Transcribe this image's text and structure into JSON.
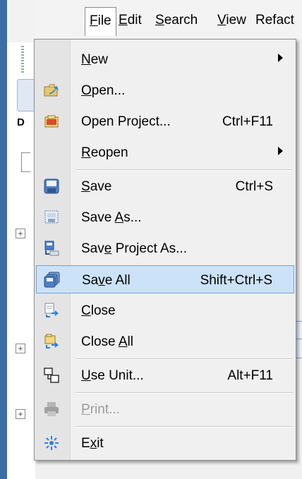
{
  "menubar": {
    "items": [
      {
        "text": "File",
        "mnemonic": "F"
      },
      {
        "text": "Edit",
        "mnemonic": "E"
      },
      {
        "text": "Search",
        "mnemonic": "S"
      },
      {
        "text": "View",
        "mnemonic": "V"
      },
      {
        "text": "Refact",
        "mnemonic": ""
      }
    ]
  },
  "file_menu": {
    "items": [
      {
        "label": "New",
        "mnemonic_index": 0,
        "shortcut": "",
        "submenu": true,
        "icon": "none"
      },
      {
        "label": "Open...",
        "mnemonic_index": 0,
        "shortcut": "",
        "icon": "open-folder-icon"
      },
      {
        "label": "Open Project...",
        "mnemonic_index": -1,
        "shortcut": "Ctrl+F11",
        "icon": "open-project-icon"
      },
      {
        "label": "Reopen",
        "mnemonic_index": 0,
        "shortcut": "",
        "submenu": true,
        "icon": "none"
      },
      {
        "label": "Save",
        "mnemonic_index": 0,
        "shortcut": "Ctrl+S",
        "icon": "save-icon"
      },
      {
        "label": "Save As...",
        "mnemonic_index": 5,
        "shortcut": "",
        "icon": "save-as-icon"
      },
      {
        "label": "Save Project As...",
        "mnemonic_index": 3,
        "shortcut": "",
        "icon": "save-project-icon"
      },
      {
        "label": "Save All",
        "mnemonic_index": 2,
        "shortcut": "Shift+Ctrl+S",
        "icon": "save-all-icon",
        "selected": true
      },
      {
        "label": "Close",
        "mnemonic_index": 0,
        "shortcut": "",
        "icon": "close-file-icon"
      },
      {
        "label": "Close All",
        "mnemonic_index": 6,
        "shortcut": "",
        "icon": "close-all-icon"
      },
      {
        "label": "Use Unit...",
        "mnemonic_index": 0,
        "shortcut": "Alt+F11",
        "icon": "use-unit-icon"
      },
      {
        "label": "Print...",
        "mnemonic_index": 0,
        "shortcut": "",
        "icon": "print-icon",
        "disabled": true
      },
      {
        "label": "Exit",
        "mnemonic_index": 1,
        "shortcut": "",
        "icon": "exit-icon"
      }
    ]
  },
  "colors": {
    "selection_bg": "#cce2f8",
    "selection_border": "#6fa3d8",
    "menu_bg": "#f0f0f0",
    "gutter_bg": "#e4e4e4",
    "disabled_text": "#9b9b9b"
  }
}
